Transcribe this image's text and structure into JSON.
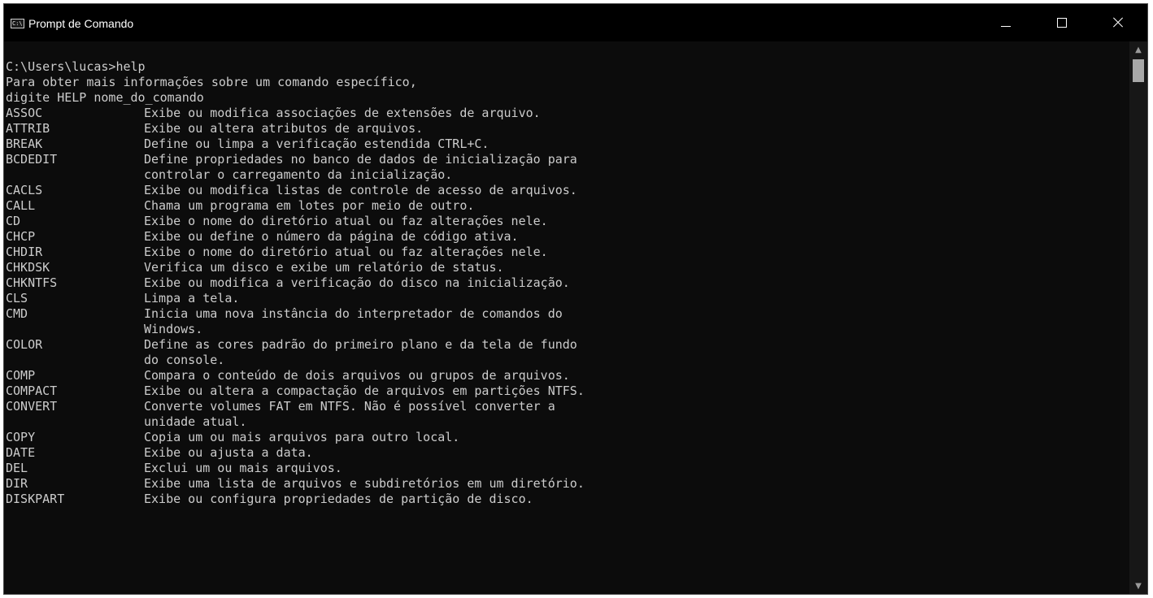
{
  "window": {
    "title": "Prompt de Comando",
    "icon_text": "C:\\.",
    "controls": {
      "minimize": "minimize-icon",
      "maximize": "maximize-icon",
      "close": "close-icon"
    }
  },
  "console": {
    "prompt": "C:\\Users\\lucas>help",
    "intro": [
      "Para obter mais informações sobre um comando específico,",
      "digite HELP nome_do_comando"
    ],
    "rows": [
      {
        "cmd": "ASSOC",
        "desc": "Exibe ou modifica associações de extensões de arquivo."
      },
      {
        "cmd": "ATTRIB",
        "desc": "Exibe ou altera atributos de arquivos."
      },
      {
        "cmd": "BREAK",
        "desc": "Define ou limpa a verificação estendida CTRL+C."
      },
      {
        "cmd": "BCDEDIT",
        "desc": "Define propriedades no banco de dados de inicialização para"
      },
      {
        "cmd": "",
        "desc": "controlar o carregamento da inicialização."
      },
      {
        "cmd": "CACLS",
        "desc": "Exibe ou modifica listas de controle de acesso de arquivos."
      },
      {
        "cmd": "CALL",
        "desc": "Chama um programa em lotes por meio de outro."
      },
      {
        "cmd": "CD",
        "desc": "Exibe o nome do diretório atual ou faz alterações nele."
      },
      {
        "cmd": "CHCP",
        "desc": "Exibe ou define o número da página de código ativa."
      },
      {
        "cmd": "CHDIR",
        "desc": "Exibe o nome do diretório atual ou faz alterações nele."
      },
      {
        "cmd": "CHKDSK",
        "desc": "Verifica um disco e exibe um relatório de status."
      },
      {
        "cmd": "CHKNTFS",
        "desc": "Exibe ou modifica a verificação do disco na inicialização."
      },
      {
        "cmd": "CLS",
        "desc": "Limpa a tela."
      },
      {
        "cmd": "CMD",
        "desc": "Inicia uma nova instância do interpretador de comandos do"
      },
      {
        "cmd": "",
        "desc": "Windows."
      },
      {
        "cmd": "COLOR",
        "desc": "Define as cores padrão do primeiro plano e da tela de fundo"
      },
      {
        "cmd": "",
        "desc": "do console."
      },
      {
        "cmd": "COMP",
        "desc": "Compara o conteúdo de dois arquivos ou grupos de arquivos."
      },
      {
        "cmd": "COMPACT",
        "desc": "Exibe ou altera a compactação de arquivos em partições NTFS."
      },
      {
        "cmd": "CONVERT",
        "desc": "Converte volumes FAT em NTFS. Não é possível converter a"
      },
      {
        "cmd": "",
        "desc": "unidade atual."
      },
      {
        "cmd": "COPY",
        "desc": "Copia um ou mais arquivos para outro local."
      },
      {
        "cmd": "DATE",
        "desc": "Exibe ou ajusta a data."
      },
      {
        "cmd": "DEL",
        "desc": "Exclui um ou mais arquivos."
      },
      {
        "cmd": "DIR",
        "desc": "Exibe uma lista de arquivos e subdiretórios em um diretório."
      },
      {
        "cmd": "DISKPART",
        "desc": "Exibe ou configura propriedades de partição de disco."
      }
    ]
  },
  "scrollbar": {
    "up": "▲",
    "down": "▼"
  },
  "colors": {
    "background": "#0c0c0c",
    "text": "#cccccc",
    "titlebar": "#000000"
  }
}
